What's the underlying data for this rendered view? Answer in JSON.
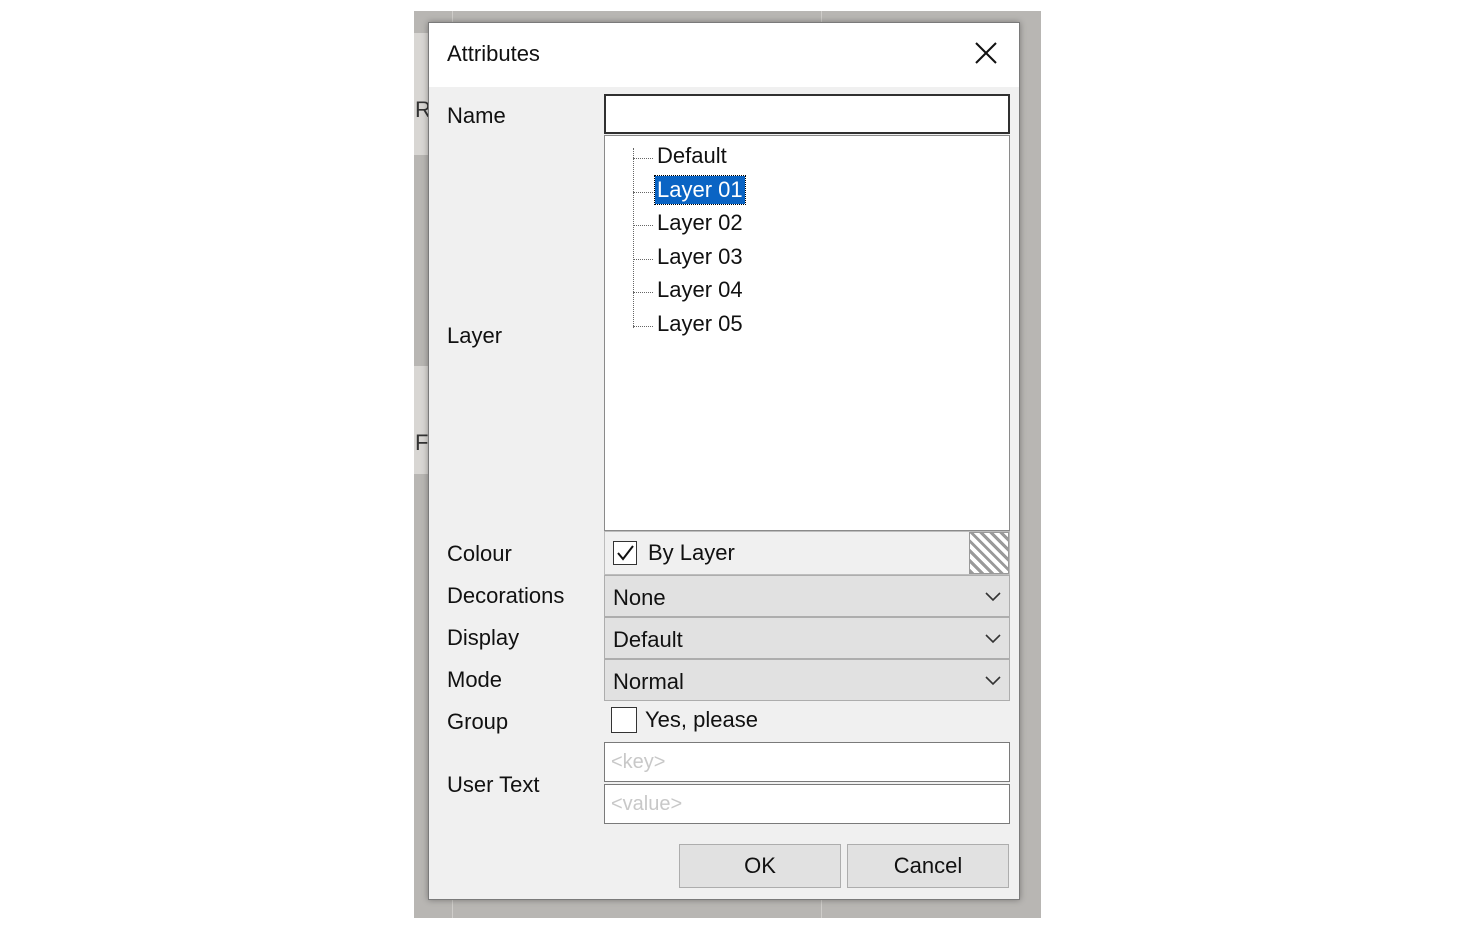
{
  "background": {
    "tab_letter_1": "R",
    "tab_letter_2": "F"
  },
  "dialog": {
    "title": "Attributes",
    "close_icon": "close-icon"
  },
  "fields": {
    "name_label": "Name",
    "name_value": "",
    "layer_label": "Layer",
    "layers": [
      "Default",
      "Layer 01",
      "Layer 02",
      "Layer 03",
      "Layer 04",
      "Layer 05"
    ],
    "selected_layer": "Layer 01",
    "colour_label": "Colour",
    "colour_by_layer_label": "By Layer",
    "colour_by_layer_checked": true,
    "decorations_label": "Decorations",
    "decorations_value": "None",
    "display_label": "Display",
    "display_value": "Default",
    "mode_label": "Mode",
    "mode_value": "Normal",
    "group_label": "Group",
    "group_option_label": "Yes, please",
    "group_checked": false,
    "user_text_label": "User Text",
    "user_text_key_placeholder": "<key>",
    "user_text_value_placeholder": "<value>"
  },
  "buttons": {
    "ok": "OK",
    "cancel": "Cancel"
  },
  "colors": {
    "selection": "#0a64c4",
    "dialog_bg": "#f0f0f0",
    "combo_bg": "#e1e1e1"
  }
}
